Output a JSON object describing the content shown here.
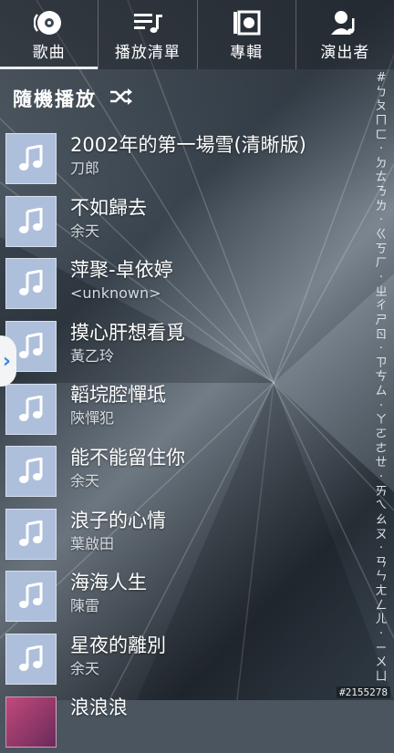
{
  "tabs": [
    {
      "label": "歌曲",
      "icon": "disc-icon",
      "active": true
    },
    {
      "label": "播放清單",
      "icon": "playlist-icon",
      "active": false
    },
    {
      "label": "專輯",
      "icon": "album-icon",
      "active": false
    },
    {
      "label": "演出者",
      "icon": "artist-icon",
      "active": false
    }
  ],
  "shuffle": {
    "label": "隨機播放",
    "icon": "shuffle-icon"
  },
  "songs": [
    {
      "title": "2002年的第一場雪(清晰版)",
      "artist": "刀郎"
    },
    {
      "title": "不如歸去",
      "artist": "余天"
    },
    {
      "title": "萍聚-卓依婷",
      "artist": "<unknown>"
    },
    {
      "title": "摸心肝想看覓",
      "artist": "黃乙玲"
    },
    {
      "title": "韜垸腔憚坻",
      "artist": "陝憚犯"
    },
    {
      "title": "能不能留住你",
      "artist": "余天"
    },
    {
      "title": "浪子的心情",
      "artist": "葉啟田"
    },
    {
      "title": "海海人生",
      "artist": "陳雷"
    },
    {
      "title": "星夜的離別",
      "artist": "余天"
    },
    {
      "title": "浪浪浪",
      "artist": ""
    }
  ],
  "index_letters": [
    "#",
    "ㄅ",
    "ㄆ",
    "ㄇ",
    "ㄈ",
    "·",
    "ㄉ",
    "ㄊ",
    "ㄋ",
    "ㄌ",
    "·",
    "ㄍ",
    "ㄎ",
    "ㄏ",
    "·",
    "ㄓ",
    "ㄔ",
    "ㄕ",
    "ㄖ",
    "·",
    "ㄗ",
    "ㄘ",
    "ㄙ",
    "·",
    "ㄚ",
    "ㄛ",
    "ㄜ",
    "ㄝ",
    "·",
    "ㄞ",
    "ㄟ",
    "ㄠ",
    "ㄡ",
    "·",
    "ㄢ",
    "ㄣ",
    "ㄤ",
    "ㄥ",
    "ㄦ",
    "·",
    "ㄧ",
    "ㄨ",
    "ㄩ"
  ],
  "watermark": "#2155278"
}
